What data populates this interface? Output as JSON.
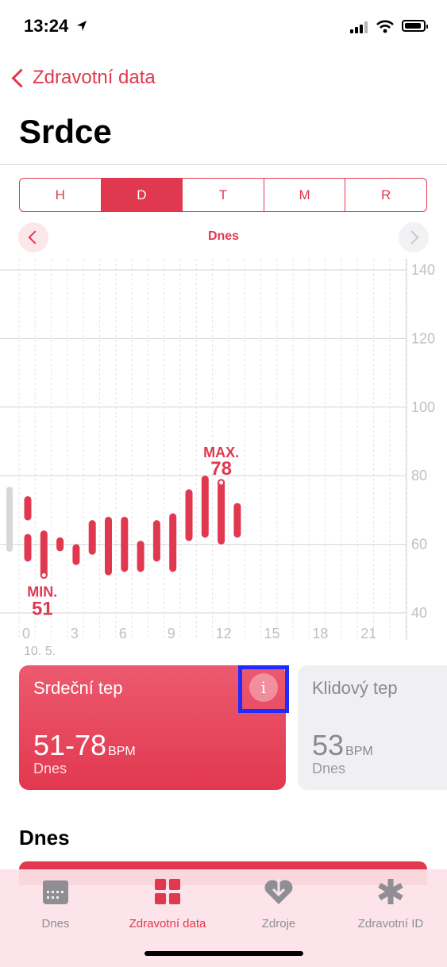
{
  "status": {
    "time": "13:24"
  },
  "nav": {
    "back_label": "Zdravotní data",
    "title": "Srdce"
  },
  "segments": [
    "H",
    "D",
    "T",
    "M",
    "R"
  ],
  "active_segment": "D",
  "date_nav": {
    "label": "Dnes"
  },
  "chart_data": {
    "type": "bar",
    "subtype": "range",
    "x_ticks": [
      "0",
      "3",
      "6",
      "9",
      "12",
      "15",
      "18",
      "21"
    ],
    "x_sublabel": "10. 5.",
    "y_ticks": [
      "140",
      "120",
      "100",
      "80",
      "60",
      "40"
    ],
    "ylim": [
      40,
      140
    ],
    "xlim": [
      0,
      24
    ],
    "bar_color": "#e0394f",
    "series": [
      {
        "values": [
          {
            "hour": 0,
            "low": 68,
            "high": 73
          },
          {
            "hour": 0,
            "low": 56,
            "high": 62
          },
          {
            "hour": 1,
            "low": 51,
            "high": 63
          },
          {
            "hour": 2,
            "low": 59,
            "high": 61
          },
          {
            "hour": 3,
            "low": 55,
            "high": 59
          },
          {
            "hour": 4,
            "low": 58,
            "high": 66
          },
          {
            "hour": 5,
            "low": 52,
            "high": 67
          },
          {
            "hour": 6,
            "low": 53,
            "high": 67
          },
          {
            "hour": 7,
            "low": 53,
            "high": 60
          },
          {
            "hour": 8,
            "low": 56,
            "high": 66
          },
          {
            "hour": 9,
            "low": 53,
            "high": 68
          },
          {
            "hour": 10,
            "low": 62,
            "high": 75
          },
          {
            "hour": 11,
            "low": 63,
            "high": 79
          },
          {
            "hour": 12,
            "low": 61,
            "high": 78
          },
          {
            "hour": 13,
            "low": 63,
            "high": 71
          }
        ]
      }
    ],
    "annotations": {
      "max": {
        "label": "MAX.",
        "value": "78"
      },
      "min": {
        "label": "MIN.",
        "value": "51"
      }
    }
  },
  "cards": {
    "heart_rate": {
      "title": "Srdeční tep",
      "value": "51-78",
      "unit": "BPM",
      "sub": "Dnes",
      "info": "i"
    },
    "resting": {
      "title": "Klidový tep",
      "value": "53",
      "unit": "BPM",
      "sub": "Dnes"
    }
  },
  "section_title": "Dnes",
  "tabs": [
    {
      "label": "Dnes",
      "icon": "calendar-icon"
    },
    {
      "label": "Zdravotní data",
      "icon": "grid-icon"
    },
    {
      "label": "Zdroje",
      "icon": "heart-download-icon"
    },
    {
      "label": "Zdravotní ID",
      "icon": "asterisk-icon"
    }
  ],
  "colors": {
    "accent": "#e0394f",
    "tint_bg": "#fbe6ea",
    "highlight": "#1f2bff"
  }
}
